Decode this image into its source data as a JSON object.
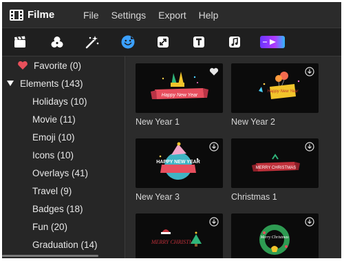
{
  "app": {
    "name": "Filme"
  },
  "menu": [
    {
      "label": "File"
    },
    {
      "label": "Settings"
    },
    {
      "label": "Export"
    },
    {
      "label": "Help"
    }
  ],
  "toolbar": [
    {
      "icon": "media-clapper-icon"
    },
    {
      "icon": "filters-icon"
    },
    {
      "icon": "effects-sparkle-icon"
    },
    {
      "icon": "stickers-smiley-icon",
      "active": true
    },
    {
      "icon": "transitions-icon"
    },
    {
      "icon": "text-icon"
    },
    {
      "icon": "music-icon"
    },
    {
      "icon": "promo-banner-icon"
    }
  ],
  "sidebar": {
    "favorite": "Favorite (0)",
    "elements": "Elements (143)",
    "categories": [
      "Holidays (10)",
      "Movie (11)",
      "Emoji (10)",
      "Icons (10)",
      "Overlays (41)",
      "Travel (9)",
      "Badges (18)",
      "Fun (20)",
      "Graduation (14)"
    ]
  },
  "grid": {
    "items": [
      {
        "title": "New Year 1",
        "art_text": "Happy New Year",
        "status": "favorited"
      },
      {
        "title": "New Year 2",
        "art_text": "Happy New Year",
        "status": "download"
      },
      {
        "title": "New Year 3",
        "art_text": "HAPPY NEW YEAR",
        "status": "download"
      },
      {
        "title": "Christmas 1",
        "art_text": "MERRY CHRISTMAS",
        "status": "download"
      },
      {
        "title": "",
        "art_text": "MERRY CHRISTMAS",
        "status": "download"
      },
      {
        "title": "",
        "art_text": "Merry Christmas",
        "status": "download"
      }
    ]
  },
  "colors": {
    "accent": "#3ba0ff",
    "heart": "#e8505b",
    "background": "#2a2a2a"
  }
}
